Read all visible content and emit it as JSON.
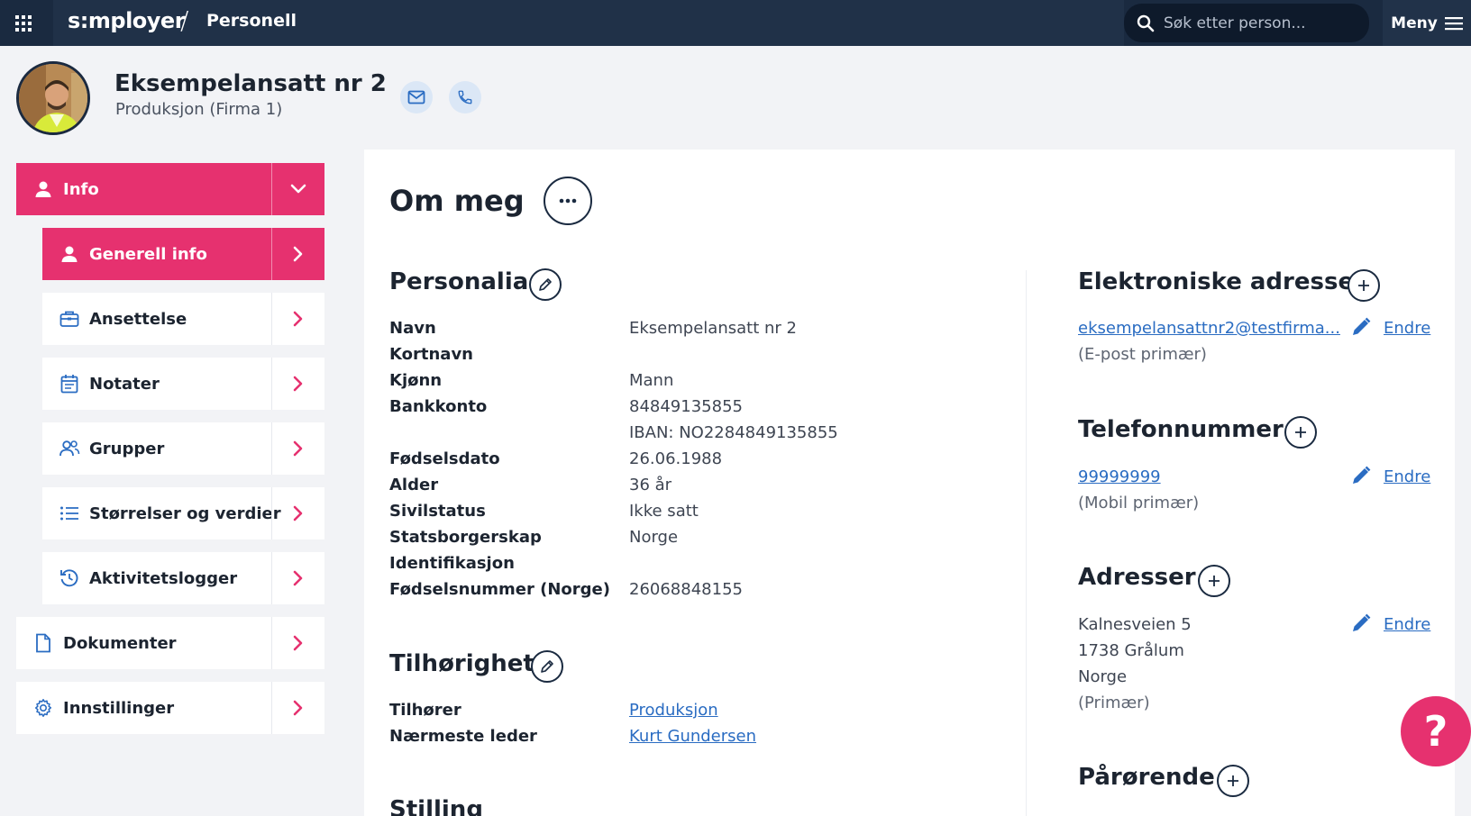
{
  "topbar": {
    "logo": "s:mployer",
    "separator": "/",
    "module": "Personell",
    "search_placeholder": "Søk etter person...",
    "menu_label": "Meny"
  },
  "profile": {
    "name": "Eksempelansatt nr 2",
    "department": "Produksjon (Firma 1)"
  },
  "sidebar": {
    "items": [
      {
        "label": "Info",
        "icon": "person-icon",
        "chevron": "down"
      },
      {
        "label": "Generell info",
        "icon": "person-icon",
        "chevron": "right"
      },
      {
        "label": "Ansettelse",
        "icon": "briefcase-icon",
        "chevron": "right"
      },
      {
        "label": "Notater",
        "icon": "calendar-icon",
        "chevron": "right"
      },
      {
        "label": "Grupper",
        "icon": "group-icon",
        "chevron": "right"
      },
      {
        "label": "Størrelser og verdier",
        "icon": "list-icon",
        "chevron": "right"
      },
      {
        "label": "Aktivitetslogger",
        "icon": "history-icon",
        "chevron": "right"
      },
      {
        "label": "Dokumenter",
        "icon": "document-icon",
        "chevron": "right"
      },
      {
        "label": "Innstillinger",
        "icon": "gear-icon",
        "chevron": "right"
      }
    ]
  },
  "main": {
    "title": "Om meg",
    "personalia": {
      "title": "Personalia",
      "fields": [
        {
          "label": "Navn",
          "value": "Eksempelansatt nr 2"
        },
        {
          "label": "Kortnavn",
          "value": ""
        },
        {
          "label": "Kjønn",
          "value": "Mann"
        },
        {
          "label": "Bankkonto",
          "value": "84849135855"
        },
        {
          "label": "",
          "value": "IBAN: NO2284849135855"
        },
        {
          "label": "Fødselsdato",
          "value": "26.06.1988"
        },
        {
          "label": "Alder",
          "value": "36 år"
        },
        {
          "label": "Sivilstatus",
          "value": "Ikke satt"
        },
        {
          "label": "Statsborgerskap",
          "value": "Norge"
        },
        {
          "label": "Identifikasjon",
          "value": ""
        },
        {
          "label": "Fødselsnummer (Norge)",
          "value": "26068848155"
        }
      ]
    },
    "tilhorighet": {
      "title": "Tilhørighet",
      "fields": [
        {
          "label": "Tilhører",
          "value": "Produksjon"
        },
        {
          "label": "Nærmeste leder",
          "value": "Kurt Gundersen"
        }
      ]
    },
    "stilling_title": "Stilling",
    "elektroniske": {
      "title": "Elektroniske adresser",
      "email": "eksempelansattnr2@testfirma...",
      "email_note": "(E-post primær)",
      "edit_label": "Endre"
    },
    "telefon": {
      "title": "Telefonnummer",
      "number": "99999999",
      "note": "(Mobil primær)",
      "edit_label": "Endre"
    },
    "adresser": {
      "title": "Adresser",
      "lines": [
        "Kalnesveien 5",
        "1738 Grålum",
        "Norge",
        "(Primær)"
      ],
      "edit_label": "Endre"
    },
    "parorende_title": "Pårørende"
  },
  "help_label": "?",
  "colors": {
    "accent": "#e6316f",
    "topbar": "#1a2a40",
    "link": "#2a6cc2"
  }
}
